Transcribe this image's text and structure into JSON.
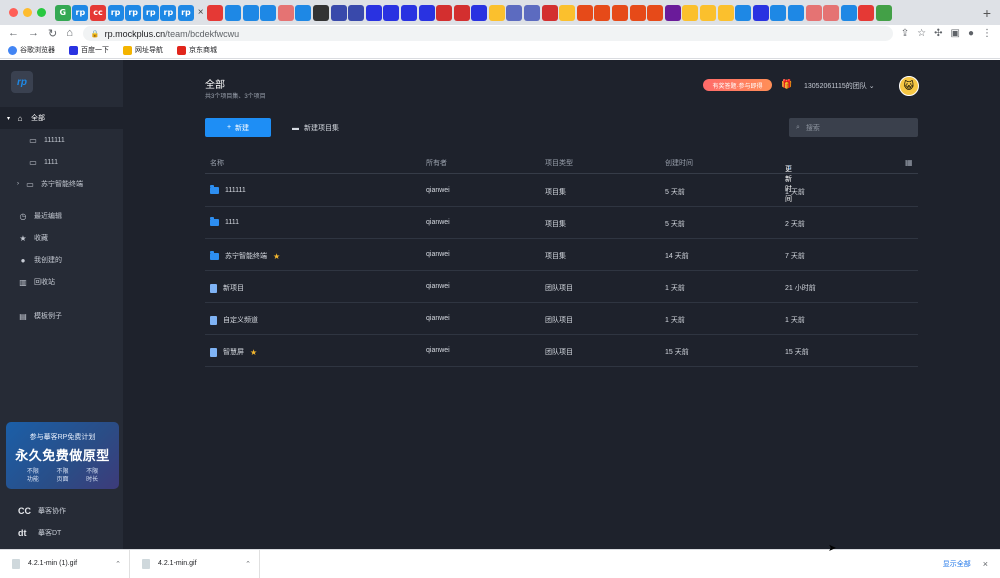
{
  "browser": {
    "url_host": "rp.mockplus.cn",
    "url_path": "/team/bcdekfwcwu",
    "bookmarks": [
      "谷歌浏览器",
      "百度一下",
      "网址导航",
      "京东商城"
    ],
    "new_tab_symbol": "+",
    "close_tab_symbol": "×"
  },
  "sidebar": {
    "logo": "rp",
    "items": [
      {
        "label": "全部",
        "icon": "home-icon"
      },
      {
        "label": "111111",
        "icon": "folder-icon"
      },
      {
        "label": "1111",
        "icon": "folder-icon"
      },
      {
        "label": "苏宁智能终端",
        "icon": "folder-icon"
      },
      {
        "label": "最近编辑",
        "icon": "clock-icon"
      },
      {
        "label": "收藏",
        "icon": "star-icon"
      },
      {
        "label": "我创建的",
        "icon": "user-icon"
      },
      {
        "label": "回收站",
        "icon": "trash-icon"
      },
      {
        "label": "模板例子",
        "icon": "template-icon"
      }
    ],
    "promo": {
      "line1": "参与摹客RP免费计划",
      "line2": "永久免费做原型",
      "features": [
        [
          "不限",
          "功能"
        ],
        [
          "不限",
          "页面"
        ],
        [
          "不限",
          "时长"
        ]
      ]
    },
    "bottom": [
      {
        "mark": "CC",
        "label": "摹客协作"
      },
      {
        "mark": "dt",
        "label": "摹客DT"
      }
    ]
  },
  "header": {
    "title": "全部",
    "subtitle": "共3个项目集、3个项目",
    "badge": "有奖答题·参与即得",
    "team": "13052061115的团队",
    "new_button": "新建",
    "new_folder": "新建项目集",
    "search_placeholder": "搜索"
  },
  "table": {
    "columns": [
      "名称",
      "所有者",
      "项目类型",
      "创建时间",
      "更新时间"
    ],
    "rows": [
      {
        "name": "111111",
        "type_icon": "folder",
        "starred": false,
        "owner": "qianwei",
        "kind": "项目集",
        "created": "5 天前",
        "updated": "1 天前"
      },
      {
        "name": "1111",
        "type_icon": "folder",
        "starred": false,
        "owner": "qianwei",
        "kind": "项目集",
        "created": "5 天前",
        "updated": "2 天前"
      },
      {
        "name": "苏宁智能终端",
        "type_icon": "folder",
        "starred": true,
        "owner": "qianwei",
        "kind": "项目集",
        "created": "14 天前",
        "updated": "7 天前"
      },
      {
        "name": "新项目",
        "type_icon": "file",
        "starred": false,
        "owner": "qianwei",
        "kind": "团队项目",
        "created": "1 天前",
        "updated": "21 小时前"
      },
      {
        "name": "自定义频道",
        "type_icon": "file",
        "starred": false,
        "owner": "qianwei",
        "kind": "团队项目",
        "created": "1 天前",
        "updated": "1 天前"
      },
      {
        "name": "智慧屏",
        "type_icon": "file",
        "starred": true,
        "owner": "qianwei",
        "kind": "团队项目",
        "created": "15 天前",
        "updated": "15 天前"
      }
    ]
  },
  "downloads": {
    "files": [
      "4.2.1-min (1).gif",
      "4.2.1-min.gif"
    ],
    "show_all": "显示全部"
  },
  "colors": {
    "accent": "#1e8ef5",
    "bg": "#1e222c",
    "sidebar": "#262b36"
  }
}
